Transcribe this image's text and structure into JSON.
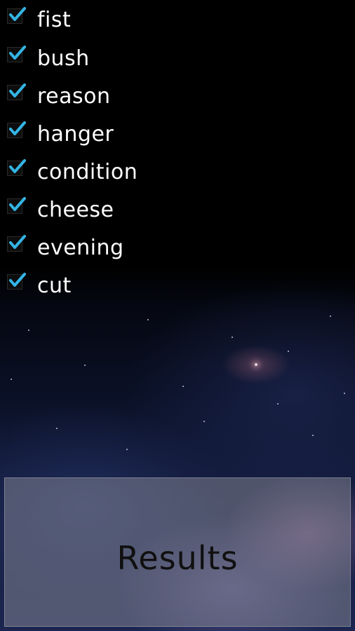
{
  "items": [
    {
      "label": "fist",
      "checked": true
    },
    {
      "label": "bush",
      "checked": true
    },
    {
      "label": "reason",
      "checked": true
    },
    {
      "label": "hanger",
      "checked": true
    },
    {
      "label": "condition",
      "checked": true
    },
    {
      "label": "cheese",
      "checked": true
    },
    {
      "label": "evening",
      "checked": true
    },
    {
      "label": "cut",
      "checked": true
    }
  ],
  "results_button": {
    "label": "Results"
  },
  "colors": {
    "check_accent": "#33b5e5",
    "text": "#ffffff",
    "button_text": "#101010"
  }
}
